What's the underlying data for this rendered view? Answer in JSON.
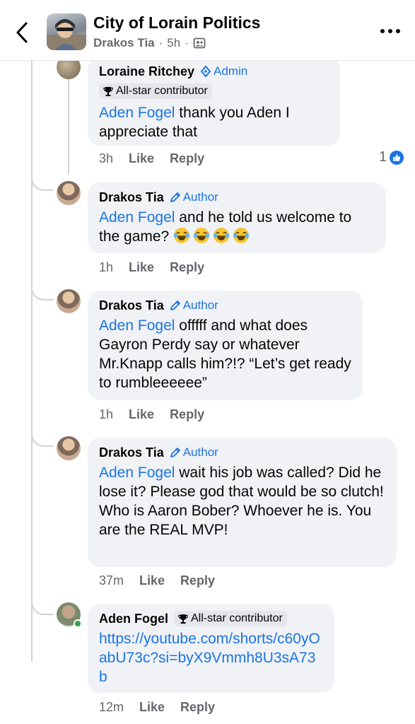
{
  "header": {
    "group_title": "City of Lorain Politics",
    "poster": "Drakos Tia",
    "time": "5h",
    "separator": "·"
  },
  "comments": [
    {
      "author": "Loraine Ritchey",
      "role": "Admin",
      "badge": "All-star contributor",
      "mention": "Aden Fogel",
      "text": " thank you  Aden  I appreciate that",
      "time": "3h",
      "like": "Like",
      "reply": "Reply",
      "reaction_count": "1"
    },
    {
      "author": "Drakos Tia",
      "role": "Author",
      "mention": "Aden Fogel",
      "text": " and he told us welcome to the game? ",
      "emojis": [
        "laughing-tears",
        "laughing-tears",
        "laughing-tears",
        "laughing-tears"
      ],
      "time": "1h",
      "like": "Like",
      "reply": "Reply"
    },
    {
      "author": "Drakos Tia",
      "role": "Author",
      "mention": "Aden Fogel",
      "text": " offfff and what does Gayron Perdy say or whatever Mr.Knapp calls him?!? “Let’s get ready to rumbleeeeee”",
      "time": "1h",
      "like": "Like",
      "reply": "Reply"
    },
    {
      "author": "Drakos Tia",
      "role": "Author",
      "mention": "Aden Fogel",
      "text": " wait his job was called? Did he lose it? Please god that would be so clutch! Who is Aaron Bober? Whoever he is. You are the REAL MVP!",
      "time": "37m",
      "like": "Like",
      "reply": "Reply"
    },
    {
      "author": "Aden Fogel",
      "badge": "All-star contributor",
      "link": "https://youtube.com/shorts/c60yOabU73c?si=byX9Vmmh8U3sA73b",
      "time": "12m",
      "like": "Like",
      "reply": "Reply"
    }
  ],
  "colors": {
    "accent": "#1b74e4",
    "bubble": "#f0f2f5",
    "secondary_text": "#65676b",
    "online": "#31a24c"
  }
}
